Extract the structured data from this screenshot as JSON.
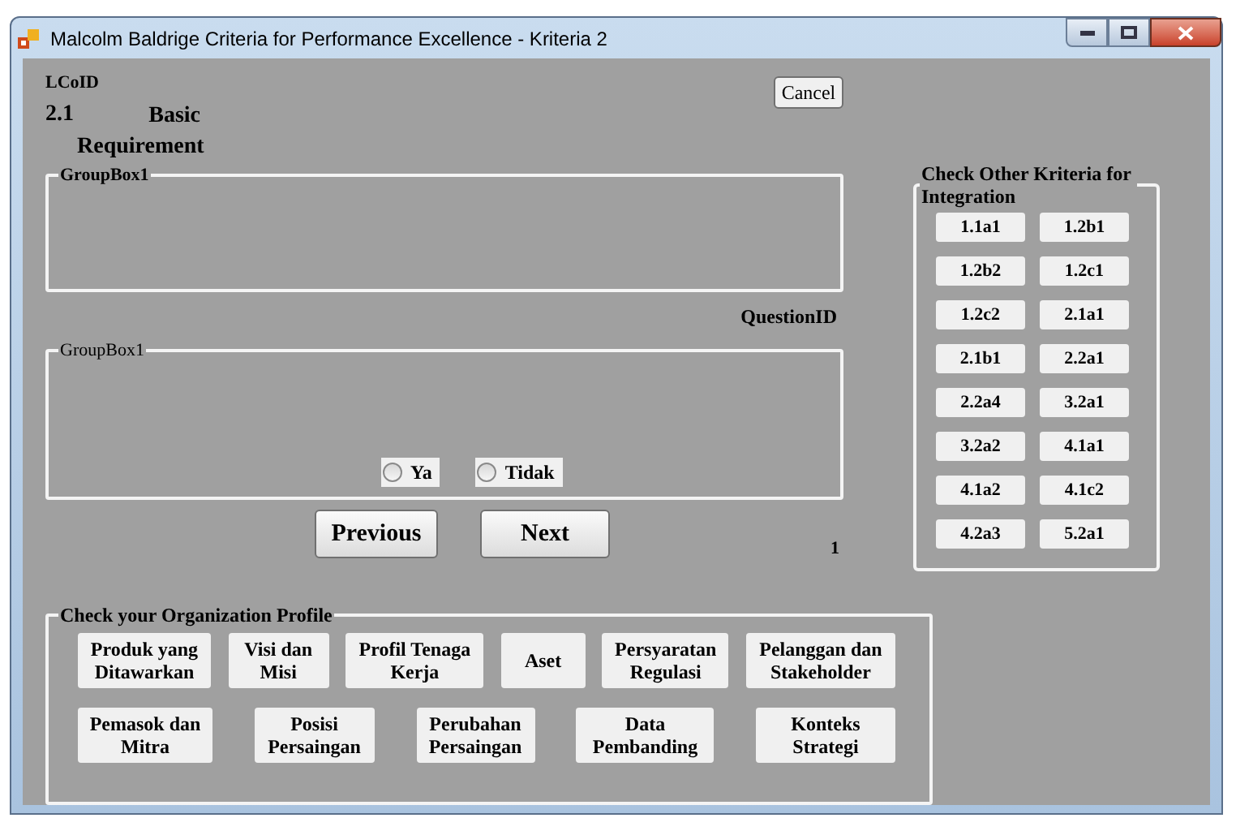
{
  "window": {
    "title": "Malcolm Baldrige Criteria for Performance Excellence - Kriteria 2"
  },
  "header": {
    "id_label": "LCoID",
    "number": "2.1",
    "title": "Basic Requirement",
    "cancel": "Cancel"
  },
  "group_top": {
    "title": "GroupBox1"
  },
  "question_id": "QuestionID",
  "group_answer": {
    "title": "GroupBox1",
    "options": [
      {
        "label": "Ya",
        "selected": false
      },
      {
        "label": "Tidak",
        "selected": false
      }
    ]
  },
  "nav": {
    "previous": "Previous",
    "next": "Next",
    "counter": "1"
  },
  "kriteria": {
    "title": "Check Other Kriteria for Integration",
    "buttons": [
      "1.1a1",
      "1.2b1",
      "1.2b2",
      "1.2c1",
      "1.2c2",
      "2.1a1",
      "2.1b1",
      "2.2a1",
      "2.2a4",
      "3.2a1",
      "3.2a2",
      "4.1a1",
      "4.1a2",
      "4.1c2",
      "4.2a3",
      "5.2a1"
    ]
  },
  "profile": {
    "title": "Check your Organization Profile",
    "buttons": [
      "Produk yang Ditawarkan",
      "Visi dan Misi",
      "Profil Tenaga Kerja",
      "Aset",
      "Persyaratan Regulasi",
      "Pelanggan dan Stakeholder",
      "Pemasok dan Mitra",
      "Posisi Persaingan",
      "Perubahan Persaingan",
      "Data Pembanding",
      "Konteks Strategi"
    ]
  }
}
